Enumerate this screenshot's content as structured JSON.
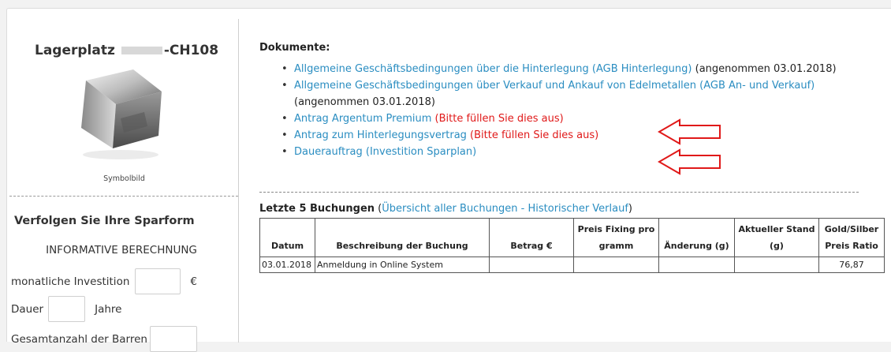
{
  "sidebar": {
    "title_prefix": "Lagerplatz",
    "title_suffix": "-CH108",
    "caption": "Symbolbild",
    "heading": "Verfolgen Sie Ihre Sparform",
    "info": "INFORMATIVE BERECHNUNG",
    "investment_label": "monatliche Investition",
    "investment_unit": "€",
    "duration_label": "Dauer",
    "duration_unit": "Jahre",
    "bars_label": "Gesamtanzahl der Barren"
  },
  "documents": {
    "heading": "Dokumente:",
    "items": [
      {
        "link": "Allgemeine Geschäftsbedingungen über die Hinterlegung (AGB Hinterlegung)",
        "status": " (angenommen 03.01.2018)",
        "status_red": false
      },
      {
        "link": "Allgemeine Geschäftsbedingungen über Verkauf und Ankauf von Edelmetallen (AGB An- und Verkauf)",
        "status": " (angenommen 03.01.2018)",
        "status_red": false
      },
      {
        "link": "Antrag Argentum Premium",
        "status": " (Bitte füllen Sie dies aus)",
        "status_red": true
      },
      {
        "link": "Antrag zum Hinterlegungsvertrag",
        "status": " (Bitte füllen Sie dies aus)",
        "status_red": true
      },
      {
        "link": "Dauerauftrag (Investition Sparplan)",
        "status": "",
        "status_red": false
      }
    ]
  },
  "bookings": {
    "heading": "Letzte 5 Buchungen",
    "open_paren": " (",
    "link": "Übersicht aller Buchungen - Historischer Verlauf",
    "close_paren": ")",
    "columns": [
      "Datum",
      "Beschreibung der Buchung",
      "Betrag €",
      "Preis Fixing pro gramm",
      "Änderung (g)",
      "Aktueller Stand (g)",
      "Gold/Silber Preis Ratio"
    ],
    "rows": [
      {
        "date": "03.01.2018",
        "description": "Anmeldung in Online System",
        "amount": "",
        "fixing": "",
        "change": "",
        "stand": "",
        "ratio": "76,87"
      }
    ]
  },
  "colors": {
    "link": "#2a8dc1",
    "warning": "#e01919",
    "arrow": "#e01919"
  }
}
